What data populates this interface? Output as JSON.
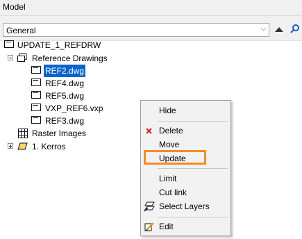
{
  "window": {
    "title": "Model"
  },
  "toolbar": {
    "filter_value": "General",
    "dropdown_icon": "chevron-down-icon",
    "up_icon": "up-arrow-icon",
    "search_icon": "search-icon"
  },
  "tree": {
    "root_label": "UPDATE_1_REFDRW",
    "reference_group_label": "Reference Drawings",
    "references": [
      "REF2.dwg",
      "REF4.dwg",
      "REF5.dwg",
      "VXP_REF6.vxp",
      "REF3.dwg"
    ],
    "selected_reference": "REF2.dwg",
    "raster_label": "Raster Images",
    "layer_label": "1. Kerros"
  },
  "context_menu": {
    "hide": "Hide",
    "delete": "Delete",
    "move": "Move",
    "update": "Update",
    "limit": "Limit",
    "cut_link": "Cut link",
    "select_layers": "Select Layers",
    "edit": "Edit",
    "highlight_color": "#f28c28"
  },
  "colors": {
    "selection": "#0a64c8",
    "delete_icon": "#c62828"
  }
}
